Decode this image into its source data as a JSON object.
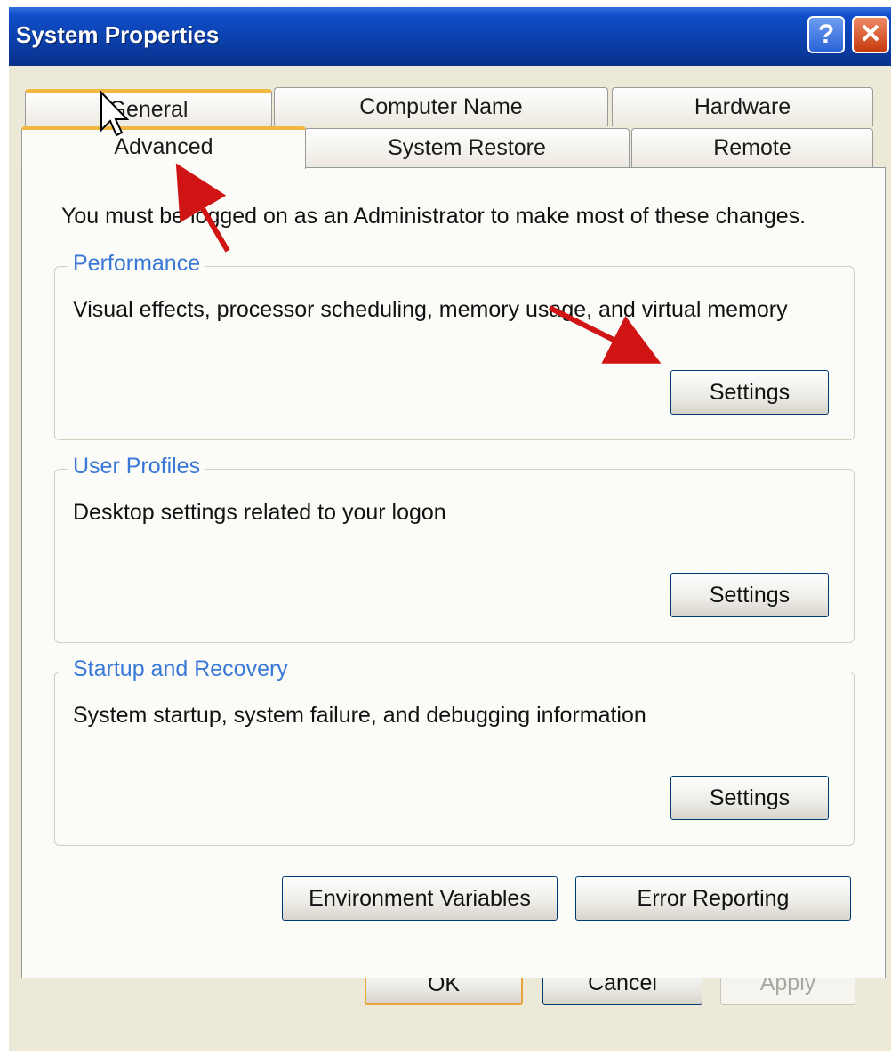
{
  "window": {
    "title": "System Properties",
    "help_icon": "?",
    "close_icon": "✕"
  },
  "tabs": {
    "row1": [
      "General",
      "Computer Name",
      "Hardware"
    ],
    "row2": [
      "Advanced",
      "System Restore",
      "Remote"
    ],
    "active": "Advanced"
  },
  "panel": {
    "admin_note": "You must be logged on as an Administrator to make most of these changes.",
    "groups": [
      {
        "title": "Performance",
        "description": "Visual effects, processor scheduling, memory usage, and virtual memory",
        "button": "Settings"
      },
      {
        "title": "User Profiles",
        "description": "Desktop settings related to your logon",
        "button": "Settings"
      },
      {
        "title": "Startup and Recovery",
        "description": "System startup, system failure, and debugging information",
        "button": "Settings"
      }
    ],
    "env_vars_button": "Environment Variables",
    "error_reporting_button": "Error Reporting"
  },
  "footer": {
    "ok": "OK",
    "cancel": "Cancel",
    "apply": "Apply"
  },
  "colors": {
    "titlebar": "#0b3fa9",
    "group_title": "#3a78d8",
    "annotation_arrow": "#d01414",
    "tab_highlight": "#f0b840"
  }
}
